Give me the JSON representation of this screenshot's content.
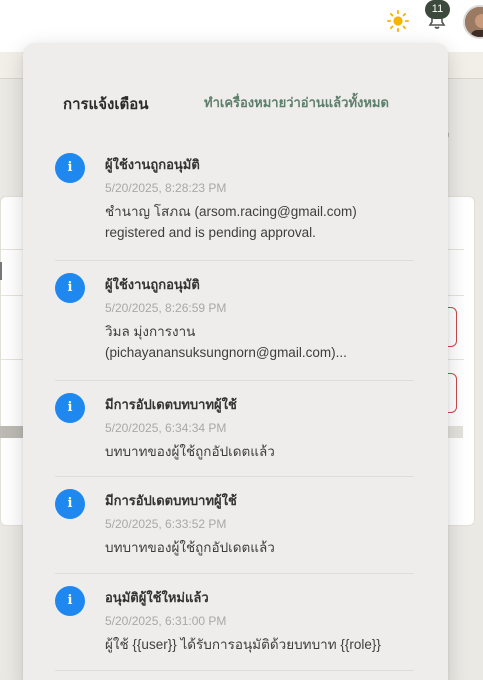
{
  "header": {
    "theme_icon": "sun-icon",
    "notifications_icon": "bell-icon",
    "notification_count": "11",
    "avatar_icon": "user-avatar"
  },
  "notifications": {
    "title": "การแจ้งเตือน",
    "mark_all_read": "ทำเครื่องหมายว่าอ่านแล้วทั้งหมด",
    "items": [
      {
        "icon": "info-icon",
        "icon_glyph": "i",
        "title": "ผู้ใช้งานถูกอนุมัติ",
        "time": "5/20/2025, 8:28:23 PM",
        "message": "ชำนาญ โสภณ (arsom.racing@gmail.com) registered and is pending approval."
      },
      {
        "icon": "info-icon",
        "icon_glyph": "i",
        "title": "ผู้ใช้งานถูกอนุมัติ",
        "time": "5/20/2025, 8:26:59 PM",
        "message": "วิมล มุ่งการงาน (pichayanansuksungnorn@gmail.com)..."
      },
      {
        "icon": "info-icon",
        "icon_glyph": "i",
        "title": "มีการอัปเดตบทบาทผู้ใช้",
        "time": "5/20/2025, 6:34:34 PM",
        "message": "บทบาทของผู้ใช้ถูกอัปเดตแล้ว"
      },
      {
        "icon": "info-icon",
        "icon_glyph": "i",
        "title": "มีการอัปเดตบทบาทผู้ใช้",
        "time": "5/20/2025, 6:33:52 PM",
        "message": "บทบาทของผู้ใช้ถูกอัปเดตแล้ว"
      },
      {
        "icon": "info-icon",
        "icon_glyph": "i",
        "title": "อนุมัติผู้ใช้ใหม่แล้ว",
        "time": "5/20/2025, 6:31:00 PM",
        "message": "ผู้ใช้ {{user}} ได้รับการอนุมัติด้วยบทบาท {{role}}"
      }
    ]
  },
  "colors": {
    "accent": "#5e7f6c",
    "info": "#1e88f0",
    "badge": "#3b4a3c",
    "panel": "#eeedeb"
  }
}
